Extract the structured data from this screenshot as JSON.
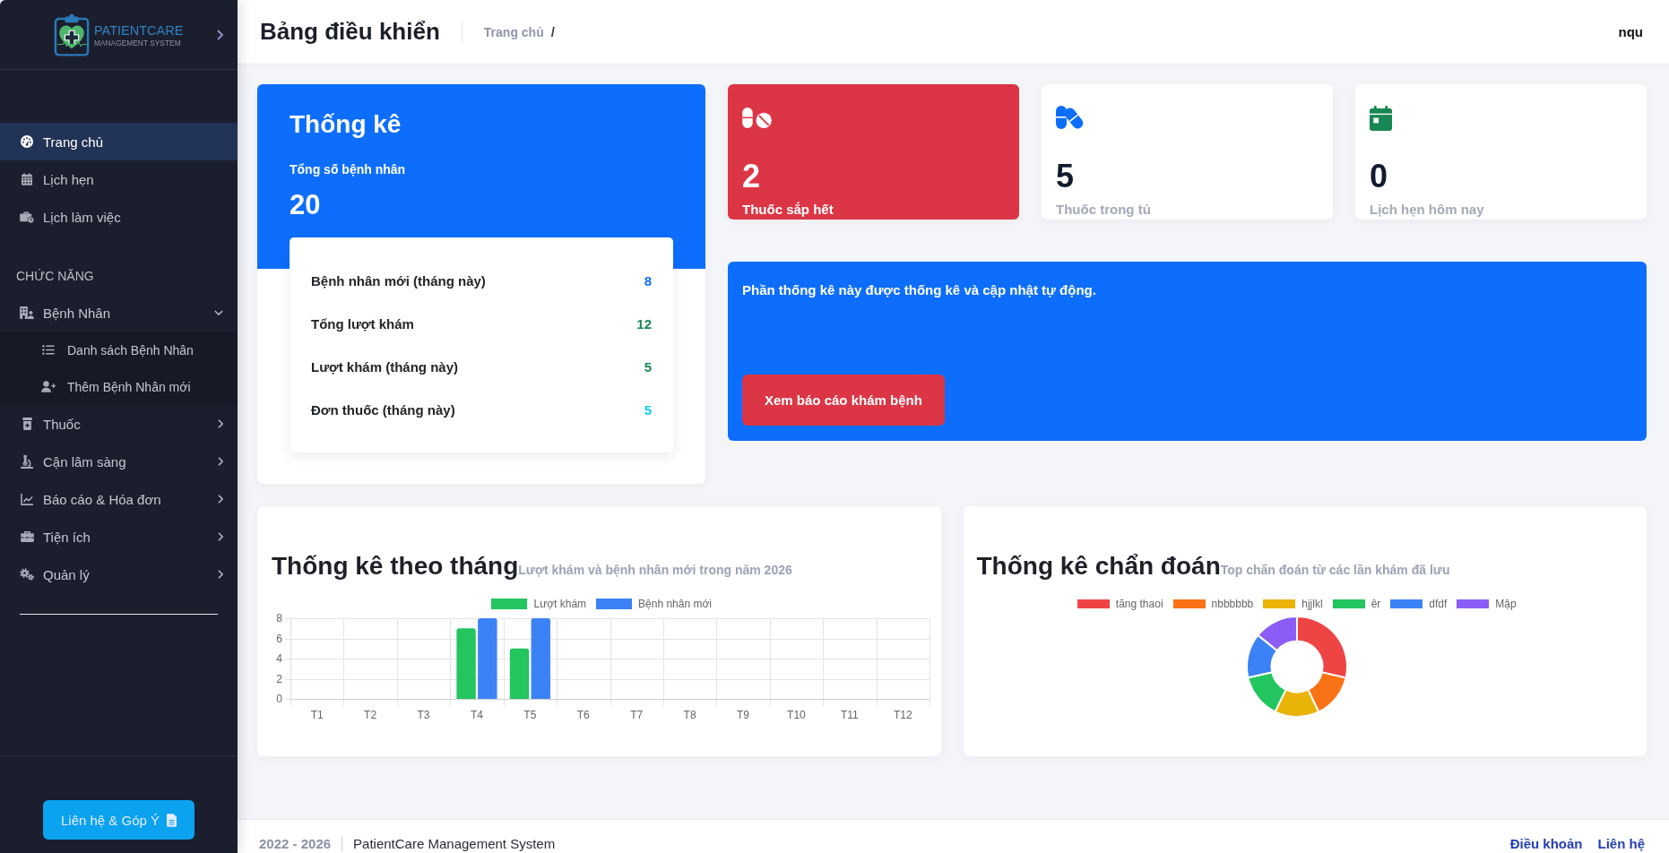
{
  "sidebar": {
    "logo": {
      "title": "PATIENTCARE",
      "subtitle": "MANAGEMENT SYSTEM"
    },
    "nav": [
      {
        "label": "Trang chủ",
        "selected": true
      },
      {
        "label": "Lịch hẹn",
        "selected": false
      },
      {
        "label": "Lịch làm việc",
        "selected": false
      }
    ],
    "section_label": "CHỨC NĂNG",
    "menu": [
      {
        "label": "Bệnh Nhân",
        "selected": false,
        "expanded": true,
        "children": [
          {
            "label": "Danh sách Bệnh Nhân",
            "selected": false
          },
          {
            "label": "Thêm Bệnh Nhân mới",
            "selected": false
          }
        ]
      },
      {
        "label": "Thuốc",
        "selected": false,
        "expanded": false
      },
      {
        "label": "Cận lâm sàng",
        "selected": false,
        "expanded": false
      },
      {
        "label": "Báo cáo & Hóa đơn",
        "selected": false,
        "expanded": false
      },
      {
        "label": "Tiện ích",
        "selected": false,
        "expanded": false
      },
      {
        "label": "Quản lý",
        "selected": false,
        "expanded": false
      }
    ],
    "contact_button": "Liên hệ & Góp Ý"
  },
  "header": {
    "title": "Bảng điều khiển",
    "breadcrumb": [
      "Trang chủ"
    ],
    "breadcrumb_separator": "/",
    "user": "nqu"
  },
  "overview": {
    "title": "Thống kê",
    "total_label": "Tổng số bệnh nhân",
    "total_value": "20",
    "rows": [
      {
        "label": "Bệnh nhân mới (tháng này)",
        "value": "8",
        "color": "#0d6efd"
      },
      {
        "label": "Tổng lượt khám",
        "value": "12",
        "color": "#198754"
      },
      {
        "label": "Lượt khám (tháng này)",
        "value": "5",
        "color": "#198754"
      },
      {
        "label": "Đơn thuốc (tháng này)",
        "value": "5",
        "color": "#0dcaf0"
      }
    ]
  },
  "stat_cards": [
    {
      "kind": "danger",
      "color": "#dc3545",
      "value": "2",
      "label": "Thuốc sắp hết"
    },
    {
      "kind": "plain",
      "color": "#0d6efd",
      "value": "5",
      "label": "Thuốc trong tủ"
    },
    {
      "kind": "plain",
      "color": "#198754",
      "value": "0",
      "label": "Lịch hẹn hôm nay"
    }
  ],
  "info_panel": {
    "text": "Phần thống kê này được thống kê và cập nhật tự động.",
    "button": "Xem báo cáo khám bệnh"
  },
  "monthly_chart": {
    "title": "Thống kê theo tháng",
    "subtitle": "Lượt khám và bệnh nhân mới trong năm 2026",
    "chart_data": {
      "type": "bar",
      "categories": [
        "T1",
        "T2",
        "T3",
        "T4",
        "T5",
        "T6",
        "T7",
        "T8",
        "T9",
        "T10",
        "T11",
        "T12"
      ],
      "series": [
        {
          "name": "Lượt khám",
          "color": "#22c55e",
          "values": [
            0,
            0,
            0,
            7,
            5,
            0,
            0,
            0,
            0,
            0,
            0,
            0
          ]
        },
        {
          "name": "Bệnh nhân mới",
          "color": "#3b82f6",
          "values": [
            0,
            0,
            0,
            8,
            8,
            0,
            0,
            0,
            0,
            0,
            0,
            0
          ]
        }
      ],
      "ylim": [
        0,
        8
      ],
      "yticks": [
        {
          "value": 0,
          "label": "0"
        },
        {
          "value": 2,
          "label": "2"
        },
        {
          "value": 4,
          "label": "4"
        },
        {
          "value": 6,
          "label": "6"
        },
        {
          "value": 8,
          "label": "8"
        }
      ],
      "grid": true,
      "legend": "top"
    }
  },
  "diagnosis_chart": {
    "title": "Thống kê chẩn đoán",
    "subtitle": "Top chẩn đoán từ các lần khám đã lưu",
    "chart_data": {
      "type": "donut",
      "categories": [
        "tăng thaoi",
        "nbbbbbb",
        "hjjlkl",
        "êr",
        "dfdf",
        "Mập"
      ],
      "values": [
        28.6,
        14.3,
        14.3,
        14.3,
        14.3,
        14.2
      ],
      "colors": [
        "#ef4444",
        "#f97316",
        "#eab308",
        "#22c55e",
        "#3b82f6",
        "#8b5cf6"
      ],
      "legend": "top"
    }
  },
  "footer": {
    "years": "2022 - 2026",
    "name": "PatientCare Management System",
    "links": [
      "Điều khoản",
      "Liên hệ"
    ]
  }
}
